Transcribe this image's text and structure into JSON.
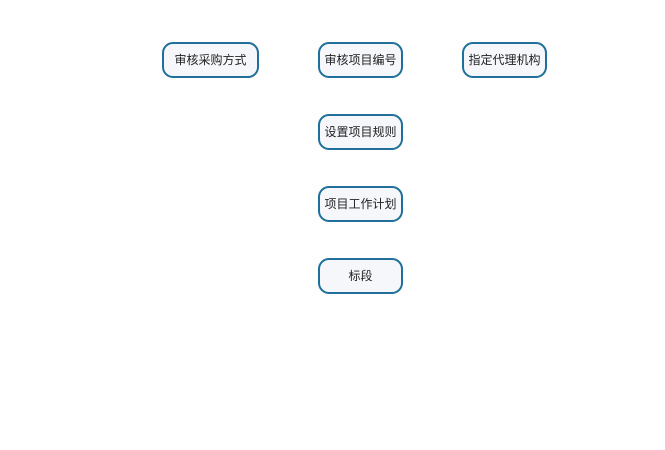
{
  "flow": {
    "nodes": [
      {
        "id": "review-procurement-method",
        "label": "审核采购方式"
      },
      {
        "id": "review-project-number",
        "label": "审核项目编号"
      },
      {
        "id": "assign-agency",
        "label": "指定代理机构"
      },
      {
        "id": "set-project-rules",
        "label": "设置项目规则"
      },
      {
        "id": "project-work-plan",
        "label": "项目工作计划"
      },
      {
        "id": "bid-section",
        "label": "标段"
      }
    ],
    "colors": {
      "node_border": "#1f6e9c",
      "node_fill": "#f5f7fb",
      "text": "#222222",
      "background": "#ffffff"
    }
  }
}
